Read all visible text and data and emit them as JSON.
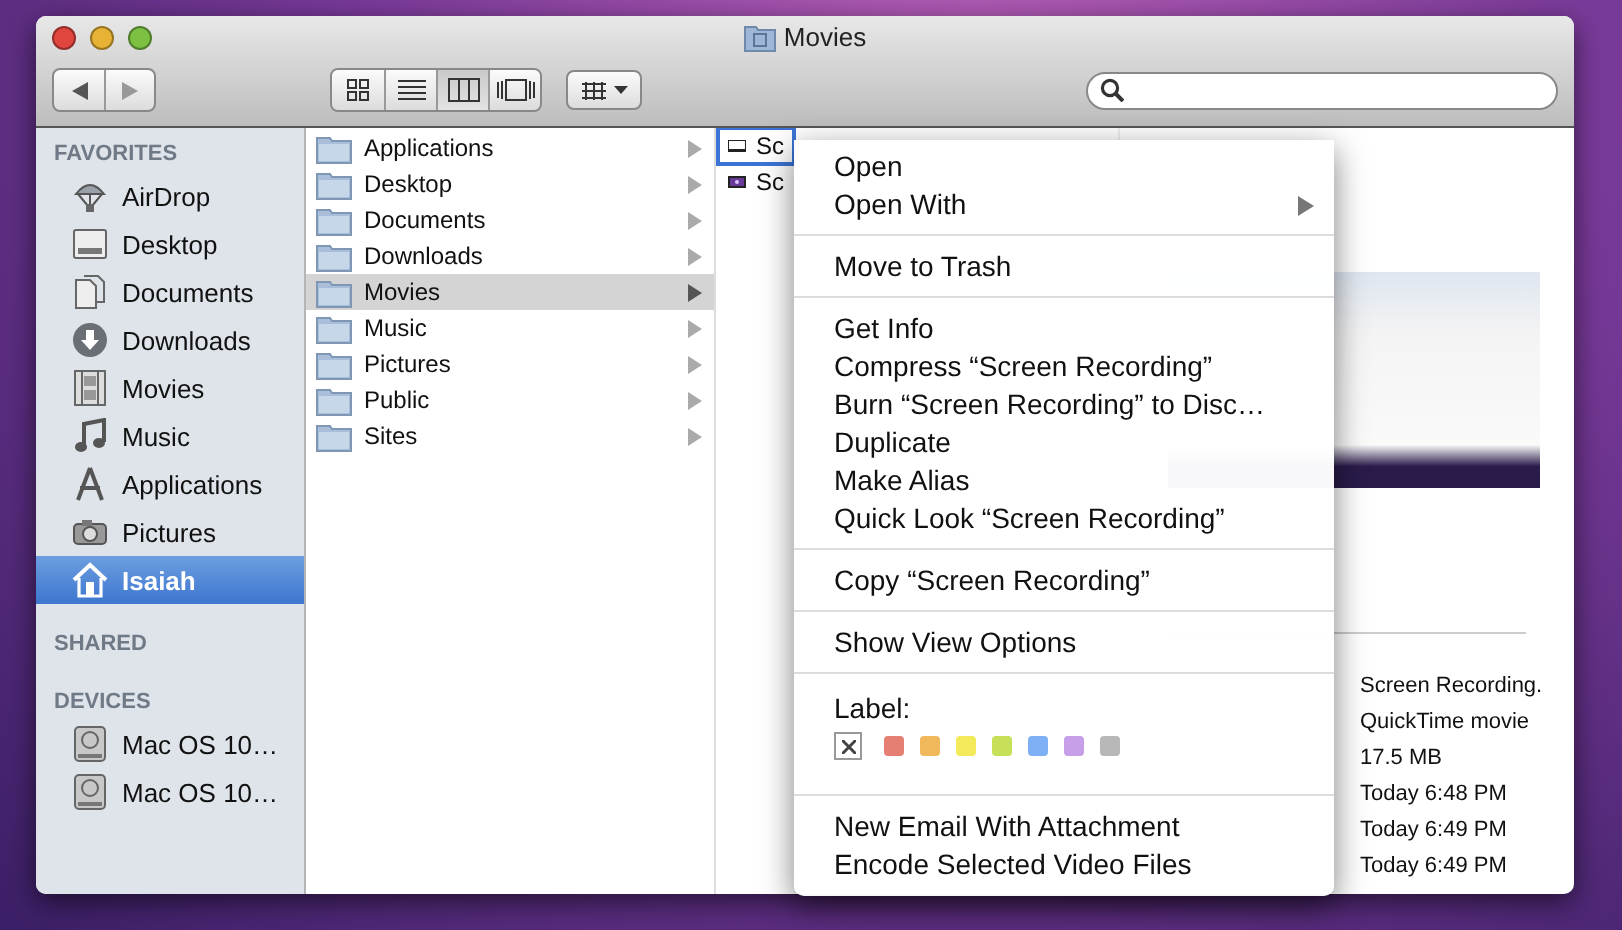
{
  "window": {
    "title": "Movies"
  },
  "toolbar": {
    "view_modes": [
      {
        "kind": "icons",
        "selected": false
      },
      {
        "kind": "list",
        "selected": false
      },
      {
        "kind": "columns",
        "selected": true
      },
      {
        "kind": "coverflow",
        "selected": false
      }
    ]
  },
  "sidebar": {
    "sections": [
      {
        "title": "FAVORITES",
        "items": [
          {
            "label": "AirDrop",
            "kind": "airdrop",
            "selected": false
          },
          {
            "label": "Desktop",
            "kind": "desktop",
            "selected": false
          },
          {
            "label": "Documents",
            "kind": "documents",
            "selected": false
          },
          {
            "label": "Downloads",
            "kind": "downloads",
            "selected": false
          },
          {
            "label": "Movies",
            "kind": "movies",
            "selected": false
          },
          {
            "label": "Music",
            "kind": "music",
            "selected": false
          },
          {
            "label": "Applications",
            "kind": "applications",
            "selected": false
          },
          {
            "label": "Pictures",
            "kind": "pictures",
            "selected": false
          },
          {
            "label": "Isaiah",
            "kind": "home",
            "selected": true
          }
        ]
      },
      {
        "title": "SHARED"
      },
      {
        "title": "DEVICES",
        "items": [
          {
            "label": "Mac OS 10…",
            "kind": "disk",
            "selected": false
          },
          {
            "label": "Mac OS 10…",
            "kind": "disk",
            "selected": false
          }
        ]
      }
    ]
  },
  "column_1": {
    "items": [
      {
        "label": "Applications",
        "selected": false
      },
      {
        "label": "Desktop",
        "selected": false
      },
      {
        "label": "Documents",
        "selected": false
      },
      {
        "label": "Downloads",
        "selected": false
      },
      {
        "label": "Movies",
        "selected": true
      },
      {
        "label": "Music",
        "selected": false
      },
      {
        "label": "Pictures",
        "selected": false
      },
      {
        "label": "Public",
        "selected": false
      },
      {
        "label": "Sites",
        "selected": false
      }
    ]
  },
  "column_2": {
    "items": [
      {
        "label": "Sc",
        "kind": "blank-movie",
        "selected": true
      },
      {
        "label": "Sc",
        "kind": "thumb-movie",
        "selected": false
      }
    ]
  },
  "preview": {
    "info": [
      "Screen Recording.",
      "QuickTime movie",
      "17.5 MB",
      "Today 6:48 PM",
      "Today 6:49 PM",
      "Today 6:49 PM"
    ]
  },
  "context_menu": {
    "items": [
      {
        "kind": "item",
        "label": "Open"
      },
      {
        "kind": "submenu",
        "label": "Open With"
      },
      {
        "kind": "separator"
      },
      {
        "kind": "item",
        "label": "Move to Trash"
      },
      {
        "kind": "separator"
      },
      {
        "kind": "item",
        "label": "Get Info"
      },
      {
        "kind": "item",
        "label": "Compress “Screen Recording”"
      },
      {
        "kind": "item",
        "label": "Burn “Screen Recording” to Disc…"
      },
      {
        "kind": "item",
        "label": "Duplicate"
      },
      {
        "kind": "item",
        "label": "Make Alias"
      },
      {
        "kind": "item",
        "label": "Quick Look “Screen Recording”"
      },
      {
        "kind": "separator"
      },
      {
        "kind": "item",
        "label": "Copy “Screen Recording”"
      },
      {
        "kind": "separator"
      },
      {
        "kind": "item",
        "label": "Show View Options"
      },
      {
        "kind": "separator"
      },
      {
        "kind": "labels",
        "label": "Label:",
        "swatches": [
          {
            "color": "#e57f73"
          },
          {
            "color": "#f0b85a"
          },
          {
            "color": "#f2ea5a"
          },
          {
            "color": "#c6e05a"
          },
          {
            "color": "#7fb0f5"
          },
          {
            "color": "#c79ee8"
          },
          {
            "color": "#b8b8b8"
          }
        ]
      },
      {
        "kind": "separator"
      },
      {
        "kind": "item",
        "label": "New Email With Attachment"
      },
      {
        "kind": "item",
        "label": "Encode Selected Video Files"
      }
    ]
  }
}
